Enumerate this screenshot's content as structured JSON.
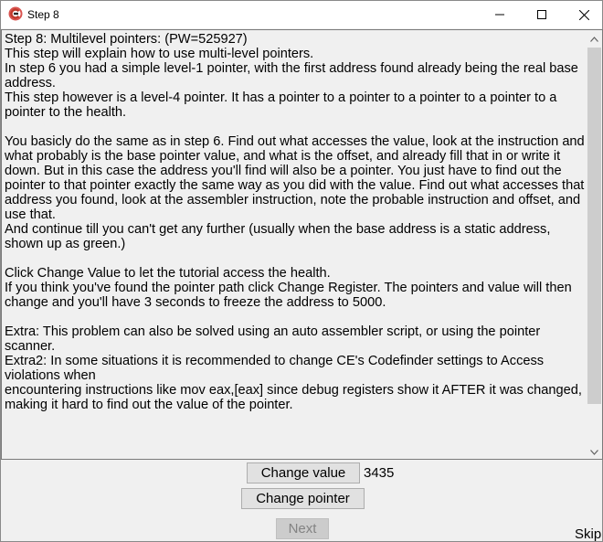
{
  "window": {
    "title": "Step 8",
    "icon": "cheat-engine-icon"
  },
  "controls": {
    "minimize_icon": "minimize-icon",
    "maximize_icon": "maximize-icon",
    "close_icon": "close-icon"
  },
  "instructions": {
    "text": "Step 8: Multilevel pointers: (PW=525927)\nThis step will explain how to use multi-level pointers.\nIn step 6 you had a simple level-1 pointer, with the first address found already being the real base address.\nThis step however is a level-4 pointer. It has a pointer to a pointer to a pointer to a pointer to a pointer to the health.\n\nYou basicly do the same as in step 6. Find out what accesses the value, look at the instruction and what probably is the base pointer value, and what is the offset, and already fill that in or write it down. But in this case the address you'll find will also be a pointer. You just have to find out the pointer to that pointer exactly the same way as you did with the value. Find out what accesses that address you found, look at the assembler instruction, note the probable instruction and offset, and use that.\nAnd continue till you can't get any further (usually when the base address is a static address, shown up as green.)\n\nClick Change Value to let the tutorial access the health.\nIf you think you've found the pointer path click Change Register. The pointers and value will then change and you'll have 3 seconds to freeze the address to 5000.\n\nExtra: This problem can also be solved using an auto assembler script, or using the pointer scanner.\nExtra2: In some situations it is recommended to change CE's Codefinder settings to Access violations when\nencountering instructions like mov eax,[eax] since debug registers show it AFTER it was changed, making it hard to find out the value of the pointer."
  },
  "actions": {
    "change_value_label": "Change value",
    "current_value": "3435",
    "change_pointer_label": "Change pointer",
    "next_label": "Next",
    "skip_label": "Skip"
  },
  "colors": {
    "background": "#f0f0f0",
    "button_face": "#e1e1e1",
    "disabled_text": "#838383"
  }
}
